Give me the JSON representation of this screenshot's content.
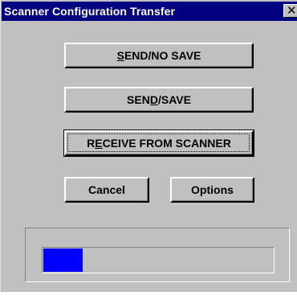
{
  "window": {
    "title": "Scanner Configuration Transfer",
    "close_glyph": "✕"
  },
  "buttons": {
    "send_no_save": {
      "pre": "",
      "mnemonic": "S",
      "post": "END/NO SAVE"
    },
    "send_save": {
      "pre": "SEN",
      "mnemonic": "D",
      "post": "/SAVE"
    },
    "receive": {
      "pre": "R",
      "mnemonic": "E",
      "post": "CEIVE FROM SCANNER"
    },
    "cancel": {
      "label": "Cancel"
    },
    "options": {
      "label": "Options"
    }
  },
  "progress": {
    "fraction": 0.17,
    "color": "#0000ff"
  },
  "colors": {
    "titlebar": "#000080",
    "face": "#c0c0c0"
  },
  "icons": {
    "close": "close-icon"
  }
}
